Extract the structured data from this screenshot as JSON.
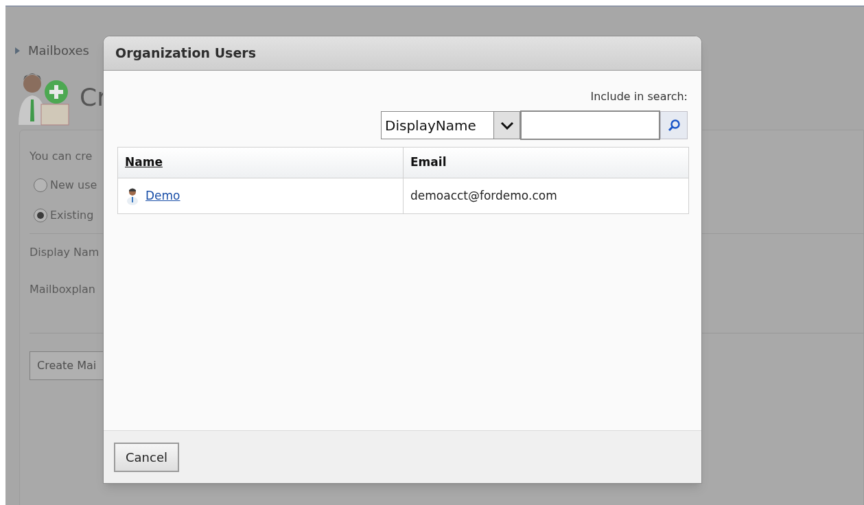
{
  "background": {
    "breadcrumb": "Mailboxes",
    "heading": "Cr",
    "intro": "You can cre",
    "options": [
      {
        "label": "New use",
        "selected": false
      },
      {
        "label": "Existing",
        "selected": true
      }
    ],
    "fields": [
      "Display Nam",
      "Mailboxplan"
    ],
    "button": "Create Mai"
  },
  "dialog": {
    "title": "Organization Users",
    "search_label": "Include in search:",
    "search_field": {
      "value": "DisplayName"
    },
    "table": {
      "columns": [
        "Name",
        "Email"
      ],
      "rows": [
        {
          "name": "Demo",
          "email": "demoacct@fordemo.com"
        }
      ]
    },
    "buttons": [
      "Cancel"
    ]
  }
}
